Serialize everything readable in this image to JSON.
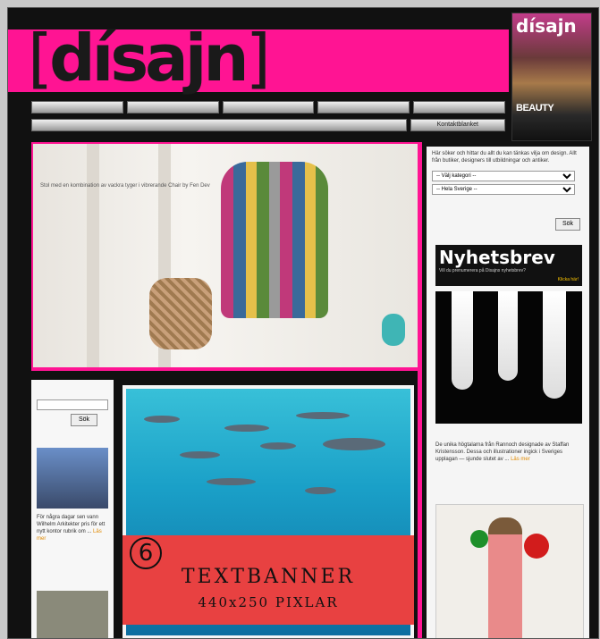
{
  "header": {
    "logo_text": "dísajn",
    "magazine_masthead": "dísajn",
    "magazine_cover_title": "BEAUTY"
  },
  "nav": {
    "row1": [
      "",
      "",
      "",
      "",
      ""
    ],
    "row2_right": "Kontaktblanket"
  },
  "hero": {
    "caption": "Stol med en kombination av vackra tyger i vibrerande Chair by Fen Dev"
  },
  "sidebar": {
    "search_text": "Här söker och hittar du allt du kan tänkas vilja om design. Allt från butiker, designers till utbildningar och antiker.",
    "select1": "-- Välj kategori --",
    "select2": "-- Hela Sverige --",
    "search_button": "Sök",
    "newsletter_title": "Nyhetsbrev",
    "newsletter_sub": "Vill du prenumerera på Disajns nyhetsbrev?",
    "newsletter_link": "Klicka här!",
    "blurb": "De unika högtalarna från Rannoch designade av Staffan Kristensson. Dessa och illustrationer ingick i Sveriges upplagan — sjunde slutet av ...",
    "blurb_more": "Läs mer"
  },
  "left_col": {
    "search_button": "Sök",
    "article_text": "För några dagar sen vann Wilhelm Arkitekter pris för ett nytt kontor rubrik om ...",
    "article_more": "Läs mer"
  },
  "banner": {
    "number": "6",
    "title": "TEXTBANNER",
    "subtitle": "440x250 PIXLAR"
  }
}
